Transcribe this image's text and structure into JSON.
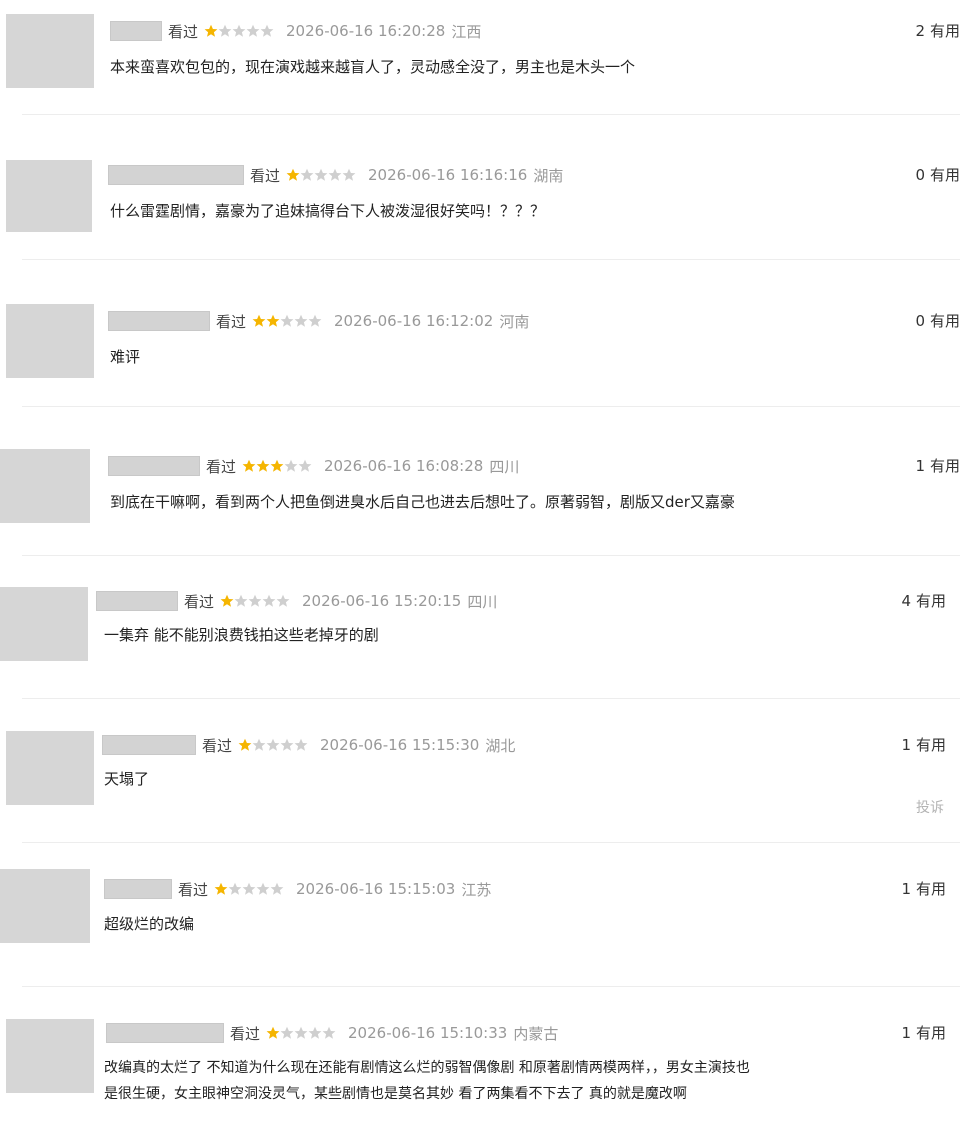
{
  "colors": {
    "star_filled": "#f5b500",
    "star_empty": "#cfcfcf",
    "avatar_placeholder": "#d6d6d6",
    "meta_text": "#999999"
  },
  "comments": [
    {
      "watched": "看过",
      "rating": 1,
      "time": "2026-06-16 16:20:28",
      "location": "江西",
      "useful_count": "2",
      "useful_label": "有用",
      "content": [
        "本来蛮喜欢包包的，现在演戏越来越盲人了，灵动感全没了，男主也是木头一个"
      ]
    },
    {
      "watched": "看过",
      "rating": 1,
      "time": "2026-06-16 16:16:16",
      "location": "湖南",
      "useful_count": "0",
      "useful_label": "有用",
      "content": [
        "什么雷霆剧情，嘉豪为了追妹搞得台下人被泼湿很好笑吗！？？？"
      ]
    },
    {
      "watched": "看过",
      "rating": 2,
      "time": "2026-06-16 16:12:02",
      "location": "河南",
      "useful_count": "0",
      "useful_label": "有用",
      "content": [
        "难评"
      ]
    },
    {
      "watched": "看过",
      "rating": 3,
      "time": "2026-06-16 16:08:28",
      "location": "四川",
      "useful_count": "1",
      "useful_label": "有用",
      "content": [
        "到底在干嘛啊，看到两个人把鱼倒进臭水后自己也进去后想吐了。原著弱智，剧版又der又嘉豪"
      ]
    },
    {
      "watched": "看过",
      "rating": 1,
      "time": "2026-06-16 15:20:15",
      "location": "四川",
      "useful_count": "4",
      "useful_label": "有用",
      "content": [
        "一集弃 能不能别浪费钱拍这些老掉牙的剧"
      ]
    },
    {
      "watched": "看过",
      "rating": 1,
      "time": "2026-06-16 15:15:30",
      "location": "湖北",
      "useful_count": "1",
      "useful_label": "有用",
      "content": [
        "天塌了"
      ],
      "report_label": "投诉"
    },
    {
      "watched": "看过",
      "rating": 1,
      "time": "2026-06-16 15:15:03",
      "location": "江苏",
      "useful_count": "1",
      "useful_label": "有用",
      "content": [
        "超级烂的改编"
      ]
    },
    {
      "watched": "看过",
      "rating": 1,
      "time": "2026-06-16 15:10:33",
      "location": "内蒙古",
      "useful_count": "1",
      "useful_label": "有用",
      "content": [
        "改编真的太烂了 不知道为什么现在还能有剧情这么烂的弱智偶像剧 和原著剧情两模两样，，男女主演技也",
        "是很生硬，女主眼神空洞没灵气，某些剧情也是莫名其妙 看了两集看不下去了 真的就是魔改啊"
      ]
    }
  ]
}
